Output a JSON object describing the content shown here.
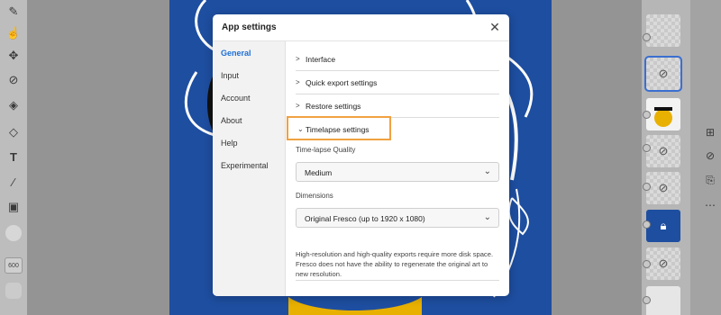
{
  "dialog": {
    "title": "App settings",
    "close_icon": "close-icon",
    "nav": [
      "General",
      "Input",
      "Account",
      "About",
      "Help",
      "Experimental"
    ],
    "active_nav": "General",
    "sections": [
      {
        "label": "Interface",
        "expanded": false
      },
      {
        "label": "Quick export settings",
        "expanded": false
      },
      {
        "label": "Restore settings",
        "expanded": false
      },
      {
        "label": "Timelapse settings",
        "expanded": true
      }
    ],
    "timelapse": {
      "quality_label": "Time-lapse Quality",
      "quality_value": "Medium",
      "dimensions_label": "Dimensions",
      "dimensions_value": "Original Fresco (up to 1920 x 1080)",
      "note": "High-resolution and high-quality exports require more disk space. Fresco does not have the ability to regenerate the original art to new resolution."
    }
  },
  "left_toolbar": {
    "tools": [
      "brush-icon",
      "smudge-icon",
      "move-icon",
      "lasso-icon",
      "fill-icon",
      "eraser-icon",
      "text-icon",
      "eyedropper-icon",
      "image-icon"
    ],
    "brush_size": "600"
  },
  "right_toolbar": {
    "actions": [
      "add-layer-icon",
      "hide-layer-icon",
      "layer-actions-icon",
      "more-icon"
    ]
  },
  "colors": {
    "accent": "#1d6fd6",
    "highlight": "#f0a141",
    "artboard": "#1e4ea0",
    "artwork_yellow": "#e8b000"
  }
}
